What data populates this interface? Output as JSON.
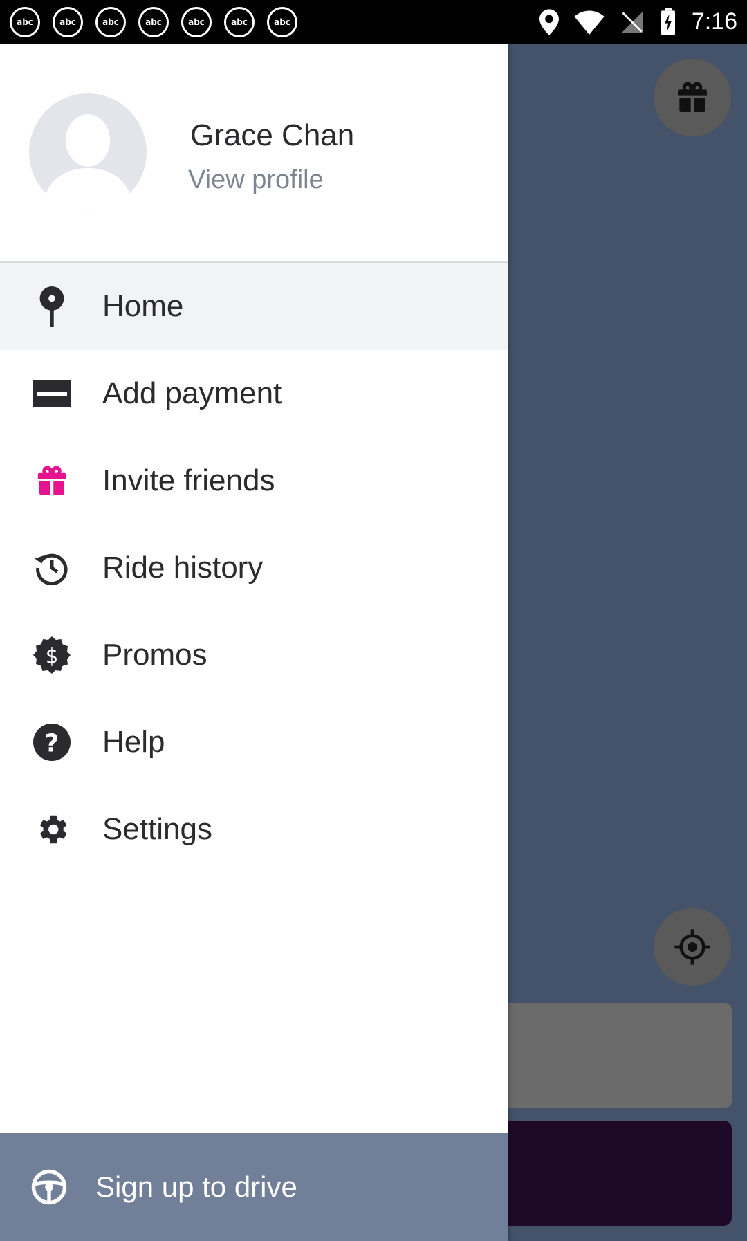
{
  "status_bar": {
    "time": "7:16",
    "notification_icons": [
      "abc",
      "abc",
      "abc",
      "abc",
      "abc",
      "abc",
      "abc"
    ]
  },
  "profile": {
    "name": "Grace Chan",
    "link": "View profile"
  },
  "menu": {
    "items": [
      {
        "label": "Home",
        "icon": "home-pin-icon",
        "active": true
      },
      {
        "label": "Add payment",
        "icon": "credit-card-icon"
      },
      {
        "label": "Invite friends",
        "icon": "gift-icon"
      },
      {
        "label": "Ride history",
        "icon": "history-clock-icon"
      },
      {
        "label": "Promos",
        "icon": "dollar-badge-icon"
      },
      {
        "label": "Help",
        "icon": "help-question-icon"
      },
      {
        "label": "Settings",
        "icon": "settings-gear-icon"
      }
    ]
  },
  "drive_button": {
    "label": "Sign up to drive",
    "icon": "steering-wheel-icon"
  },
  "colors": {
    "gift_pink": "#e6138f",
    "drawer_bg": "#ffffff",
    "drive_button_bg": "#717f98",
    "backdrop": "#44536a"
  }
}
